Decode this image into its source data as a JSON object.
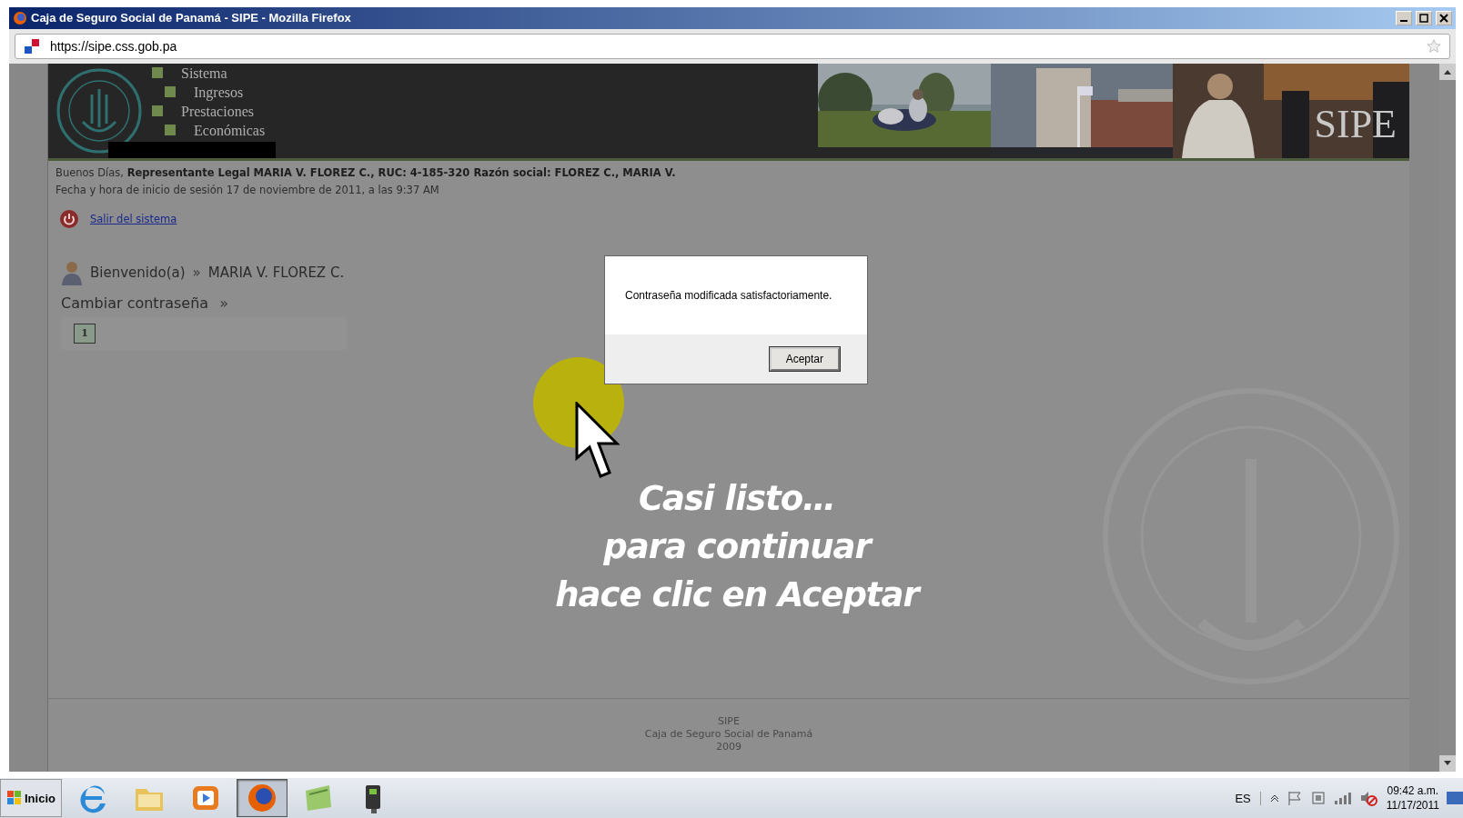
{
  "window": {
    "title": "Caja de Seguro Social de Panamá - SIPE - Mozilla Firefox"
  },
  "address_bar": {
    "url": "https://sipe.css.gob.pa"
  },
  "header": {
    "menu": [
      "Sistema",
      "Ingresos",
      "Prestaciones",
      "Económicas"
    ],
    "logo_text": "SIPE"
  },
  "session": {
    "greeting": "Buenos Días, **Representante Legal MARIA V. FLOREZ C., RUC: 4-185-320 Razón social: FLOREZ C., MARIA V.**",
    "login_time": "Fecha y hora de inicio de sesión 17 de noviembre de 2011, a las 9:37 AM",
    "logout_link": "Salir del sistema"
  },
  "breadcrumb": {
    "welcome": "Bienvenido(a)",
    "separator": "»",
    "user": "MARIA V. FLOREZ C."
  },
  "section": {
    "title": "Cambiar contraseña",
    "separator": "»",
    "pages": [
      {
        "label": "1",
        "selected": true
      }
    ]
  },
  "dialog": {
    "message": "Contraseña modificada satisfactoriamente.",
    "button": "Aceptar"
  },
  "overlay_caption": [
    "Casi listo…",
    "para continuar",
    "hace clic en Aceptar"
  ],
  "footer": [
    "SIPE",
    "Caja de Seguro Social de Panamá",
    "2009"
  ],
  "taskbar": {
    "start": "Inicio",
    "apps": [
      {
        "kind": "ie",
        "selected": false
      },
      {
        "kind": "folder",
        "selected": false
      },
      {
        "kind": "media",
        "selected": false
      },
      {
        "kind": "firefox",
        "selected": true
      },
      {
        "kind": "notes",
        "selected": false
      },
      {
        "kind": "camera",
        "selected": false
      }
    ],
    "language": "ES",
    "time": "09:42 a.m.",
    "date": "11/17/2011"
  }
}
